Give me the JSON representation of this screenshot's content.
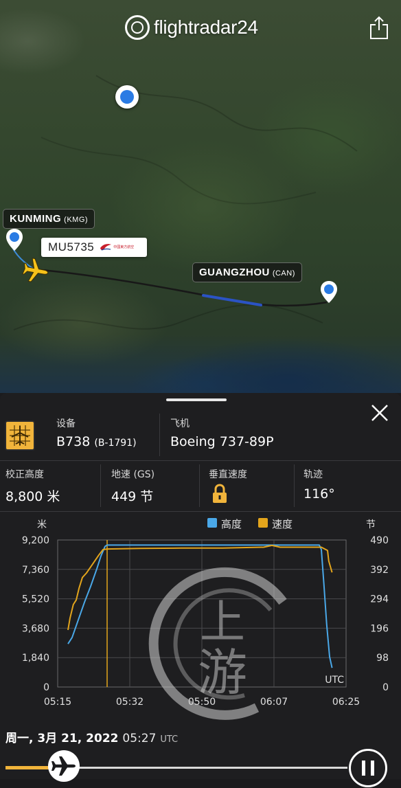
{
  "app": {
    "brand": "flightradar24"
  },
  "map": {
    "origin": {
      "name": "KUNMING",
      "code": "(KMG)"
    },
    "destination": {
      "name": "GUANGZHOU",
      "code": "(CAN)"
    },
    "flight_number": "MU5735",
    "airline_logo_text": "中國東方航空",
    "route_color": "#1b1b1b",
    "track_color": "#2b53c4"
  },
  "details": {
    "equipment_label": "设备",
    "equipment_value": "B738",
    "registration": "(B-1791)",
    "aircraft_label": "飞机",
    "aircraft_value": "Boeing 737-89P",
    "altitude_label": "校正高度",
    "altitude_value": "8,800 米",
    "speed_label": "地速 (GS)",
    "speed_value": "449 节",
    "vspeed_label": "垂直速度",
    "track_label": "轨迹",
    "track_value": "116°"
  },
  "chart_data": {
    "type": "line",
    "title": "",
    "left_axis_unit": "米",
    "right_axis_unit": "节",
    "left_ticks": [
      "9,200",
      "7,360",
      "5,520",
      "3,680",
      "1,840",
      "0"
    ],
    "right_ticks": [
      "490",
      "392",
      "294",
      "196",
      "98",
      "0"
    ],
    "x_ticks": [
      "05:15",
      "05:32",
      "05:50",
      "06:07",
      "06:25"
    ],
    "x_axis_label": "UTC",
    "ylim_left": [
      0,
      9200
    ],
    "ylim_right": [
      0,
      490
    ],
    "x_range_minutes": [
      0,
      70
    ],
    "cursor_minute": 12,
    "colors": {
      "altitude": "#4aa8e8",
      "speed": "#e3a51c"
    },
    "series": [
      {
        "name": "高度",
        "axis": "left",
        "x": [
          2.5,
          3.5,
          5,
          6.5,
          8,
          9.5,
          10.5,
          11.5,
          12,
          20,
          30,
          40,
          50,
          56,
          61,
          63.5,
          64,
          64.6,
          65.3,
          66,
          66.6
        ],
        "values": [
          2700,
          3100,
          4200,
          5300,
          6300,
          7400,
          8200,
          8800,
          8880,
          8880,
          8880,
          8880,
          8880,
          8880,
          8880,
          8880,
          8600,
          6500,
          3900,
          1900,
          1200
        ]
      },
      {
        "name": "速度",
        "axis": "right",
        "x": [
          2.5,
          3,
          3.8,
          4.5,
          5.2,
          6,
          7,
          8,
          9,
          10,
          11,
          12,
          20,
          30,
          40,
          50,
          52,
          54,
          56,
          60,
          64,
          65.5,
          65.8,
          66.6
        ],
        "values": [
          190,
          230,
          275,
          290,
          330,
          365,
          380,
          400,
          420,
          440,
          458,
          460,
          462,
          463,
          463,
          466,
          472,
          466,
          466,
          466,
          466,
          455,
          420,
          382
        ]
      }
    ]
  },
  "playback": {
    "date": "周一, 3月 21, 2022",
    "time": "05:27",
    "timezone": "UTC",
    "progress": 0.17
  }
}
